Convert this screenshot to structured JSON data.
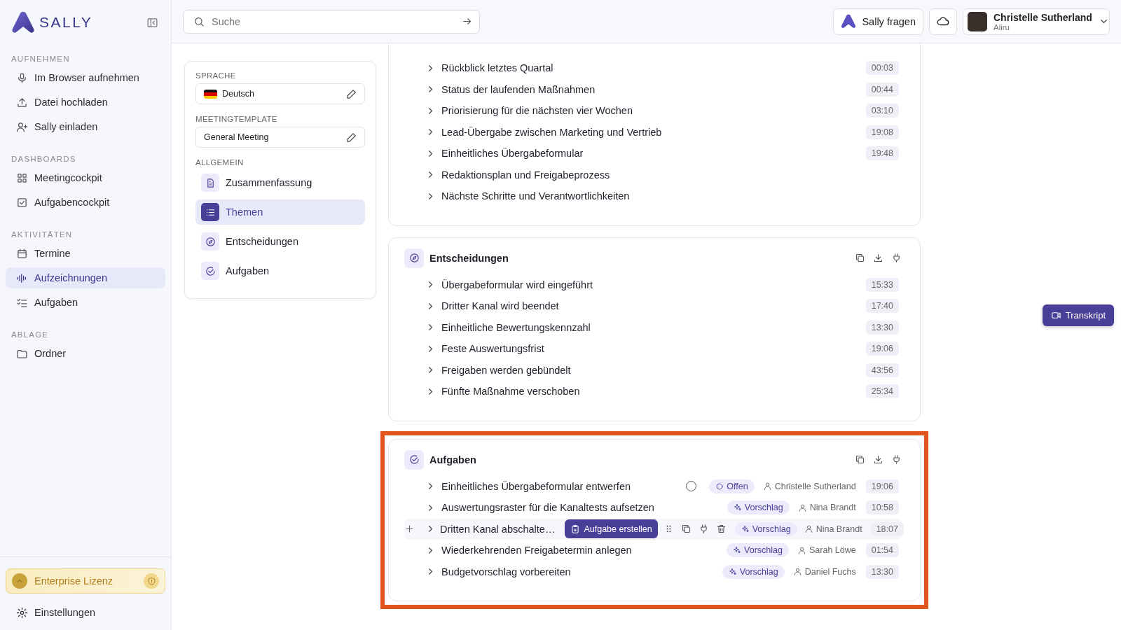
{
  "sidebar": {
    "logo": "SALLY",
    "sections": [
      {
        "title": "AUFNEHMEN",
        "items": [
          {
            "label": "Im Browser aufnehmen",
            "selected": false
          },
          {
            "label": "Datei hochladen",
            "selected": false
          },
          {
            "label": "Sally einladen",
            "selected": false
          }
        ]
      },
      {
        "title": "DASHBOARDS",
        "items": [
          {
            "label": "Meetingcockpit",
            "selected": false
          },
          {
            "label": "Aufgabencockpit",
            "selected": false
          }
        ]
      },
      {
        "title": "AKTIVITÄTEN",
        "items": [
          {
            "label": "Termine",
            "selected": false
          },
          {
            "label": "Aufzeichnungen",
            "selected": true
          },
          {
            "label": "Aufgaben",
            "selected": false
          }
        ]
      },
      {
        "title": "ABLAGE",
        "items": [
          {
            "label": "Ordner",
            "selected": false
          }
        ]
      }
    ],
    "license": "Enterprise Lizenz",
    "settings": "Einstellungen"
  },
  "topbar": {
    "search": {
      "placeholder": "Suche"
    },
    "ask_button": "Sally fragen",
    "user": {
      "name": "Christelle Sutherland",
      "org": "Aliru"
    }
  },
  "panel": {
    "fields": [
      {
        "label": "SPRACHE",
        "value": "Deutsch",
        "kind": "language"
      },
      {
        "label": "MEETINGTEMPLATE",
        "value": "General Meeting",
        "kind": "text"
      }
    ],
    "group_title": "ALLGEMEIN",
    "nav": [
      {
        "label": "Zusammenfassung",
        "selected": false
      },
      {
        "label": "Themen",
        "selected": true
      },
      {
        "label": "Entscheidungen",
        "selected": false
      },
      {
        "label": "Aufgaben",
        "selected": false
      }
    ]
  },
  "sections": [
    {
      "kind": "list",
      "highlighted": false,
      "rows": [
        {
          "title": "Rückblick letztes Quartal",
          "time": "00:03"
        },
        {
          "title": "Status der laufenden Maßnahmen",
          "time": "00:44"
        },
        {
          "title": "Priorisierung für die nächsten vier Wochen",
          "time": "03:10"
        },
        {
          "title": "Lead-Übergabe zwischen Marketing und Vertrieb",
          "time": "19:08"
        },
        {
          "title": "Einheitliches Übergabeformular",
          "time": "19:48"
        },
        {
          "title": "Redaktionsplan und Freigabeprozess"
        },
        {
          "title": "Nächste Schritte und Verantwortlichkeiten"
        }
      ]
    },
    {
      "kind": "list",
      "title": "Entscheidungen",
      "highlighted": false,
      "rows": [
        {
          "title": "Übergabeformular wird eingeführt",
          "time": "15:33"
        },
        {
          "title": "Dritter Kanal wird beendet",
          "time": "17:40"
        },
        {
          "title": "Einheitliche Bewertungskennzahl",
          "time": "13:30"
        },
        {
          "title": "Feste Auswertungsfrist",
          "time": "19:06"
        },
        {
          "title": "Freigaben werden gebündelt",
          "time": "43:56"
        },
        {
          "title": "Fünfte Maßnahme verschoben",
          "time": "25:34"
        }
      ]
    },
    {
      "kind": "tasks",
      "title": "Aufgaben",
      "highlighted": true,
      "rows": [
        {
          "title": "Einheitliches Übergabeformular entwerfen",
          "status": {
            "kind": "open",
            "label": "Offen"
          },
          "checked": false,
          "assignee": "Christelle Sutherland",
          "time": "19:06",
          "hovered": false
        },
        {
          "title": "Auswertungsraster für die Kanaltests aufsetzen",
          "status": {
            "kind": "suggestion",
            "label": "Vorschlag"
          },
          "assignee": "Nina Brandt",
          "time": "10:58",
          "hovered": false
        },
        {
          "title": "Dritten Kanal abschalte…",
          "status": {
            "kind": "suggestion",
            "label": "Vorschlag"
          },
          "assignee": "Nina Brandt",
          "time": "18:07",
          "hovered": true,
          "create_button": "Aufgabe erstellen"
        },
        {
          "title": "Wiederkehrenden Freigabetermin anlegen",
          "status": {
            "kind": "suggestion",
            "label": "Vorschlag"
          },
          "assignee": "Sarah Löwe",
          "time": "01:54",
          "hovered": false
        },
        {
          "title": "Budgetvorschlag vorbereiten",
          "status": {
            "kind": "suggestion",
            "label": "Vorschlag"
          },
          "assignee": "Daniel Fuchs",
          "time": "13:30",
          "hovered": false
        }
      ]
    }
  ],
  "transcript_button": "Transkript"
}
